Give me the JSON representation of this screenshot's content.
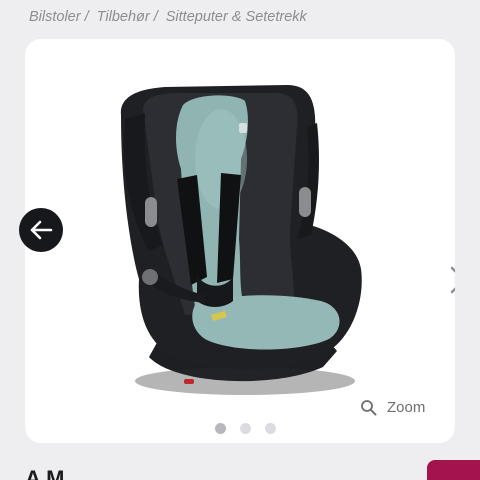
{
  "breadcrumb": {
    "items": [
      "Bilstoler /",
      "Tilbehør /",
      "Sitteputer & Setetrekk"
    ]
  },
  "gallery": {
    "image_icon": "car-seat-with-cover-image",
    "prev_icon": "arrow-left-icon",
    "next_icon": "chevron-right-icon",
    "zoom_icon": "magnifier-icon",
    "zoom_label": "Zoom",
    "slide_count": 3,
    "active_slide": 1
  },
  "product": {
    "title_partial": "A    M"
  },
  "colors": {
    "page_bg": "#eeedf0",
    "card_bg": "#ffffff",
    "accent": "#a3144d",
    "prev_button_bg": "#17181c",
    "cover_teal": "#8fb4b2"
  }
}
